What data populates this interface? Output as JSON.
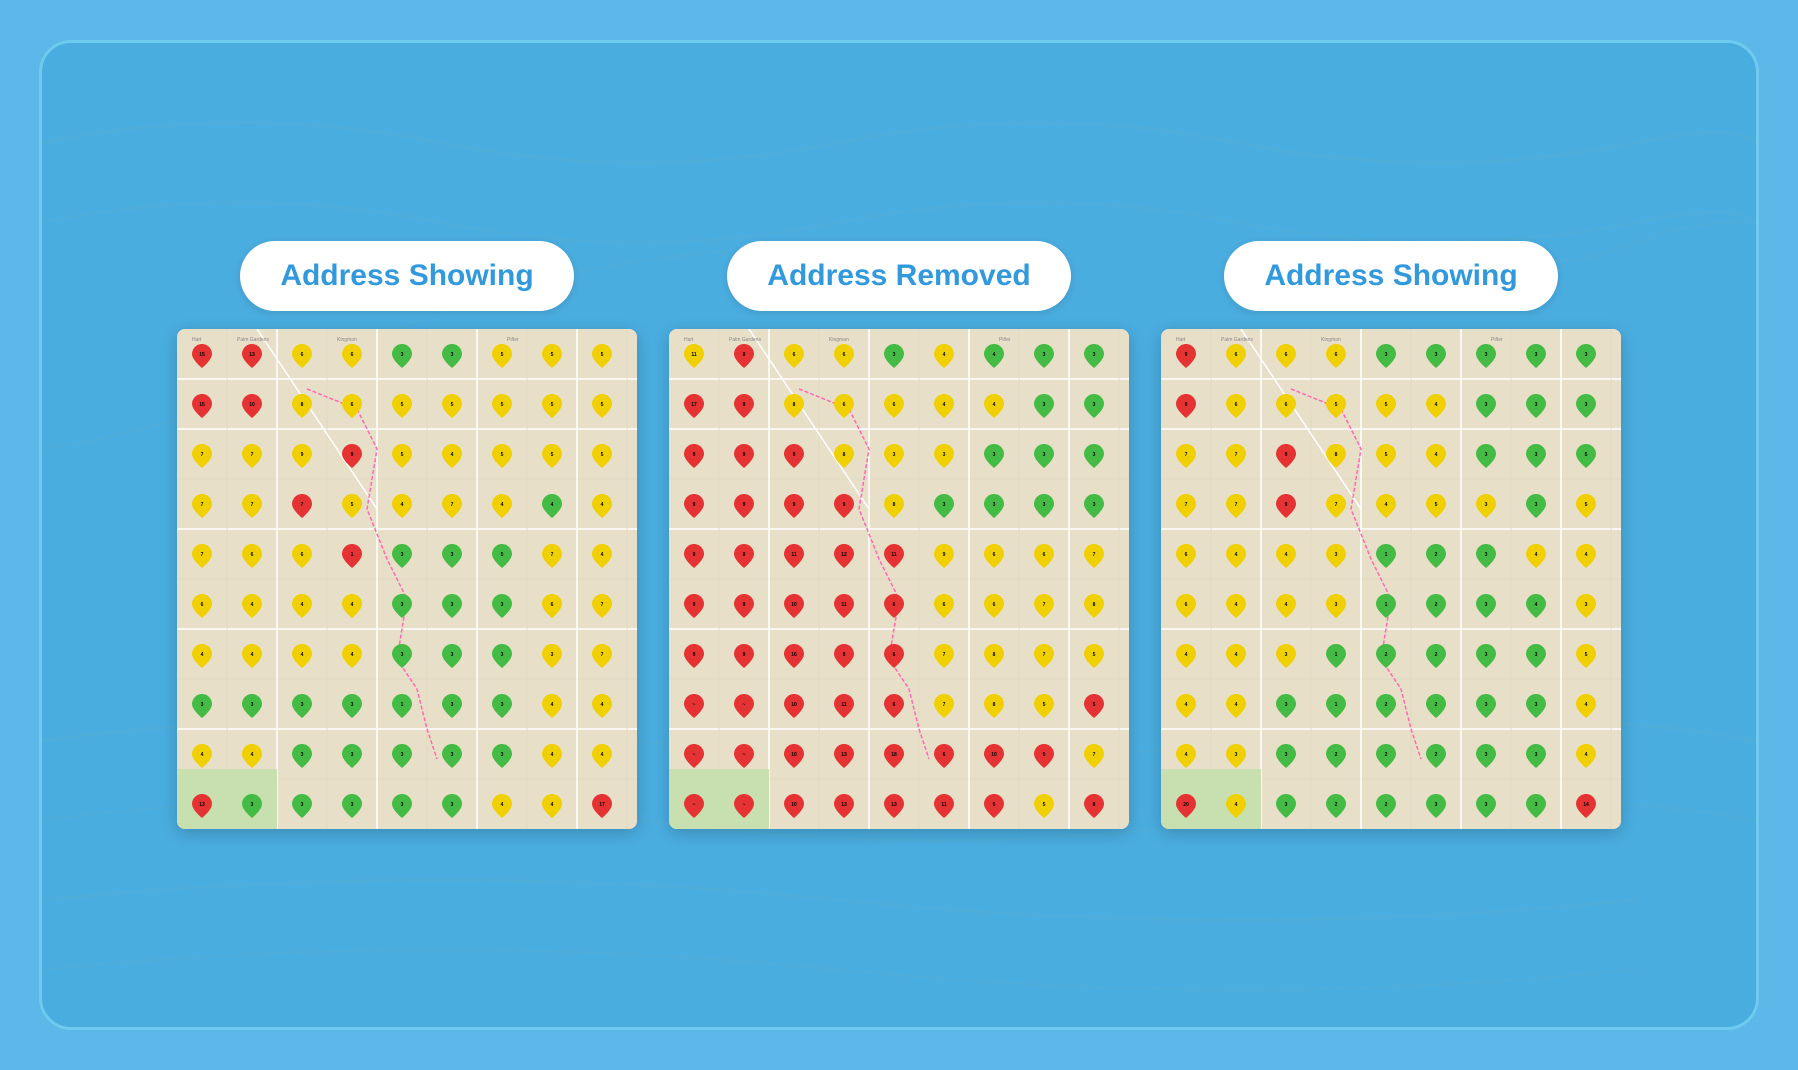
{
  "panels": [
    {
      "id": "panel-left",
      "label": "Address Showing",
      "map_type": "address_showing_left"
    },
    {
      "id": "panel-center",
      "label": "Address Removed",
      "map_type": "address_removed"
    },
    {
      "id": "panel-right",
      "label": "Address Showing",
      "map_type": "address_showing_right"
    }
  ]
}
